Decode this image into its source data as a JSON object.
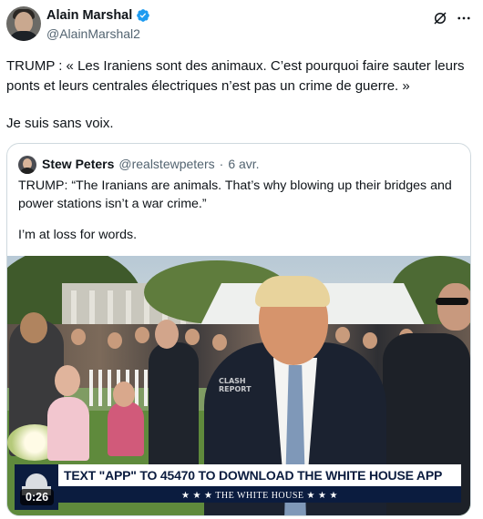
{
  "author": {
    "display_name": "Alain Marshal",
    "handle": "@AlainMarshal2",
    "verified": true
  },
  "tweet": {
    "text": "TRUMP : « Les Iraniens sont des animaux. C’est pourquoi faire sauter leurs ponts et leurs centrales électriques n’est pas un crime de guerre. »",
    "text_2": "Je suis sans voix."
  },
  "quoted": {
    "display_name": "Stew Peters",
    "handle": "@realstewpeters",
    "separator": "·",
    "date": "6 avr.",
    "text": "TRUMP: “The Iranians are animals. That’s why blowing up their bridges and power stations isn’t a war crime.”",
    "text_2": "I’m at loss for words.",
    "video": {
      "watermark_line1": "CLASH",
      "watermark_line2": "REPORT",
      "banner_text": "TEXT \"APP\" TO 45470 TO DOWNLOAD THE WHITE HOUSE APP",
      "banner_subtext": "★ ★ ★  THE WHITE HOUSE  ★ ★ ★",
      "duration": "0:26"
    }
  },
  "icons": {
    "verified": "verified-badge-icon",
    "grok": "grok-icon",
    "more": "more-icon"
  },
  "colors": {
    "verified_blue": "#1d9bf0",
    "secondary_text": "#536471",
    "border": "#cfd9de",
    "banner_navy": "#0b1c3f"
  }
}
